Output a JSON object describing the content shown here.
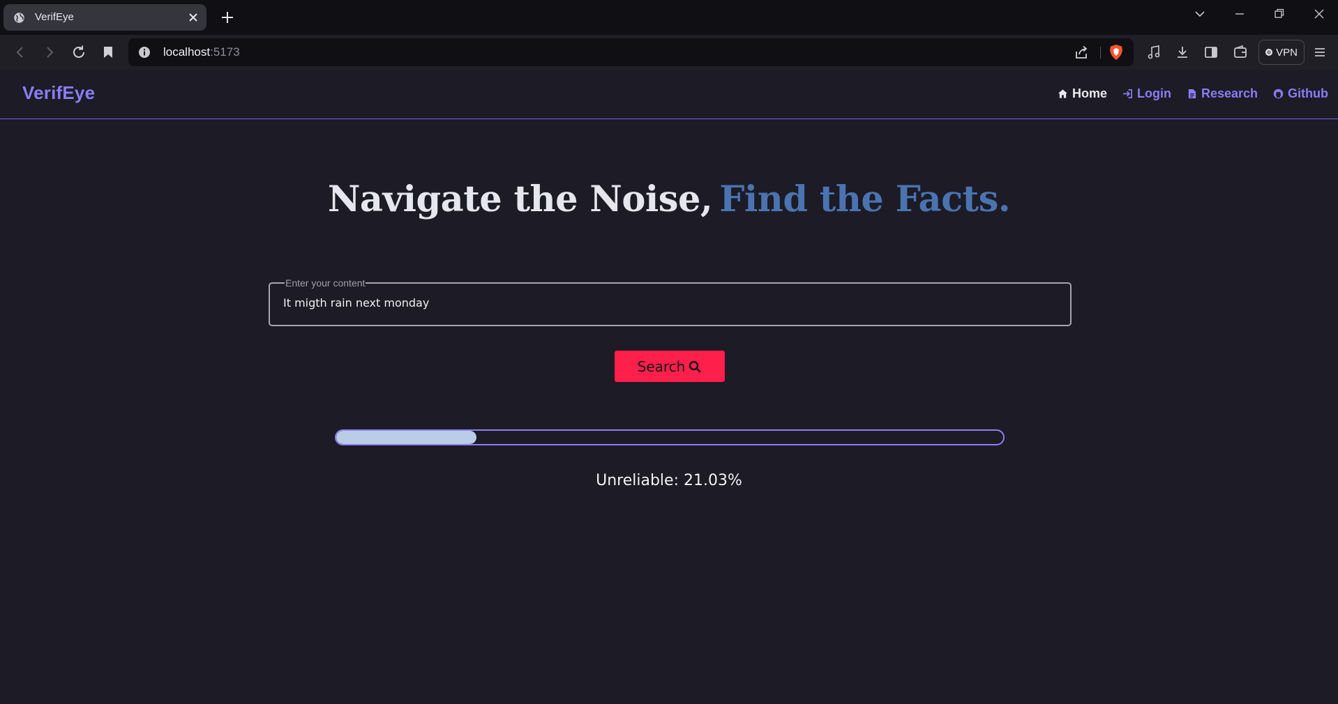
{
  "browser": {
    "tab_title": "VerifEye",
    "url_host": "localhost",
    "url_port": ":5173",
    "vpn_label": "VPN",
    "icons": [
      "globe-icon",
      "close-icon",
      "plus-icon",
      "chevron-down-icon",
      "minimize-icon",
      "restore-icon",
      "close-window-icon",
      "back-icon",
      "forward-icon",
      "reload-icon",
      "bookmark-icon",
      "info-icon",
      "share-icon",
      "brave-shield-icon",
      "music-icon",
      "download-icon",
      "sidebar-icon",
      "wallet-icon",
      "menu-icon"
    ]
  },
  "navbar": {
    "brand": "VerifEye",
    "links": [
      {
        "label": "Home",
        "icon": "home-icon",
        "active": true
      },
      {
        "label": "Login",
        "icon": "login-icon",
        "active": false
      },
      {
        "label": "Research",
        "icon": "document-icon",
        "active": false
      },
      {
        "label": "Github",
        "icon": "github-icon",
        "active": false
      }
    ]
  },
  "hero": {
    "headline_main": "Navigate the Noise,",
    "headline_accent": "Find the Facts."
  },
  "form": {
    "input_label": "Enter your content",
    "input_value": "It migth rain next monday",
    "search_label": "Search",
    "search_icon": "search-icon"
  },
  "result": {
    "progress_fraction": 0.2103,
    "text": "Unreliable: 21.03%"
  },
  "colors": {
    "background": "#1c1b26",
    "brand": "#8b7cf4",
    "accent_headline": "#4a73b0",
    "button": "#ff1f4b",
    "progress_fill": "#b9cde6"
  }
}
